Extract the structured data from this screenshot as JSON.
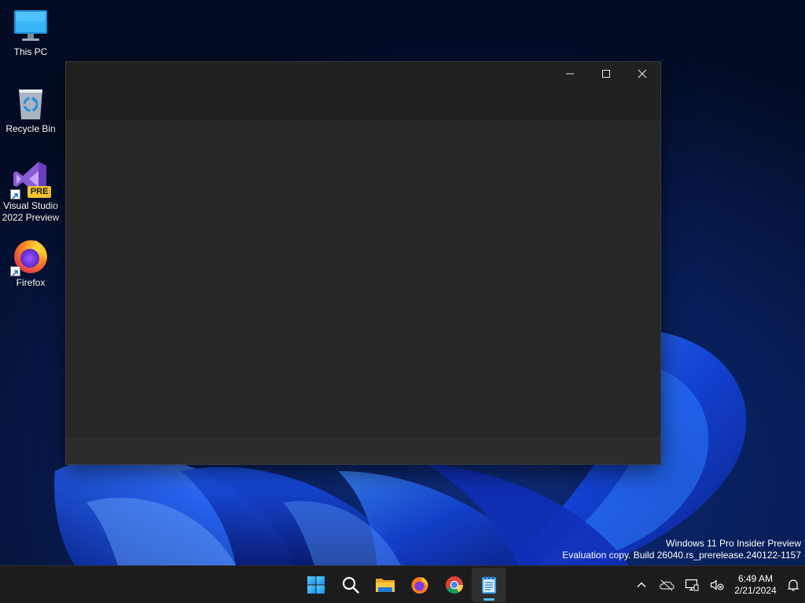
{
  "desktop": {
    "icons": [
      {
        "label": "This PC",
        "icon": "this-pc-icon"
      },
      {
        "label": "Recycle Bin",
        "icon": "recycle-bin-icon"
      },
      {
        "label": "Visual Studio 2022 Preview",
        "icon": "visual-studio-preview-icon",
        "badge": "PRE"
      },
      {
        "label": "Firefox",
        "icon": "firefox-icon"
      }
    ]
  },
  "window": {
    "controls": [
      "minimize",
      "maximize",
      "close"
    ]
  },
  "watermark": {
    "line1": "Windows 11 Pro Insider Preview",
    "line2": "Evaluation copy. Build 26040.rs_prerelease.240122-1157"
  },
  "taskbar": {
    "apps": [
      {
        "name": "Start",
        "icon": "windows-start-icon"
      },
      {
        "name": "Search",
        "icon": "search-icon"
      },
      {
        "name": "File Explorer",
        "icon": "file-explorer-icon"
      },
      {
        "name": "Firefox",
        "icon": "firefox-icon"
      },
      {
        "name": "Chrome",
        "icon": "chrome-icon"
      },
      {
        "name": "Notepad",
        "icon": "notepad-icon",
        "active": true
      }
    ],
    "tray": {
      "time": "6:49 AM",
      "date": "2/21/2024"
    }
  },
  "colors": {
    "accent": "#4cc2ff",
    "taskbar": "#1c1c1c",
    "window_bg": "#272727",
    "titlebar_bg": "#202020"
  }
}
